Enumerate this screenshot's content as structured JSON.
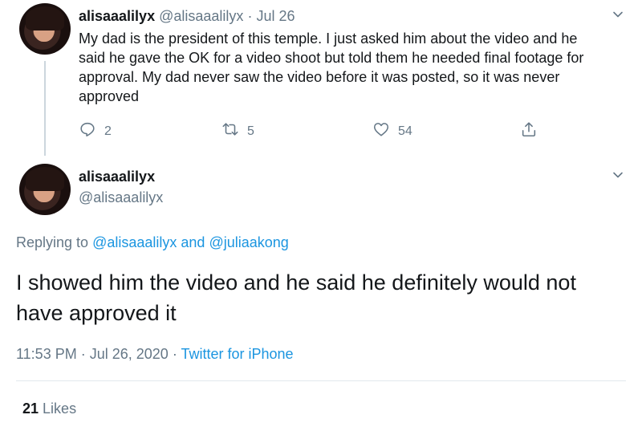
{
  "tweet1": {
    "display_name": "alisaaalilyx",
    "handle": "@alisaaalilyx",
    "separator": "·",
    "date": "Jul 26",
    "text": "My dad is the president of this temple. I just asked him about the video and he said he gave the OK for a video shoot but told them he needed final footage for approval. My dad never saw the video before it was posted, so it was never approved",
    "reply_count": "2",
    "retweet_count": "5",
    "like_count": "54",
    "icons": [
      "reply-icon",
      "retweet-icon",
      "like-icon",
      "share-icon"
    ]
  },
  "tweet2": {
    "display_name": "alisaaalilyx",
    "handle": "@alisaaalilyx",
    "replying_prefix": "Replying to",
    "replying_user1": "@alisaaalilyx",
    "replying_and": "and",
    "replying_user2": "@juliaakong",
    "text": "I showed him the video and he said he definitely would not have approved it",
    "timestamp": "11:53 PM · Jul 26, 2020",
    "meta_separator": "·",
    "source": "Twitter for iPhone",
    "likes_count": "21",
    "likes_label": "Likes"
  },
  "colors": {
    "text": "#14171a",
    "muted": "#657786",
    "link": "#1b95e0",
    "divider": "#e1e8ed"
  }
}
